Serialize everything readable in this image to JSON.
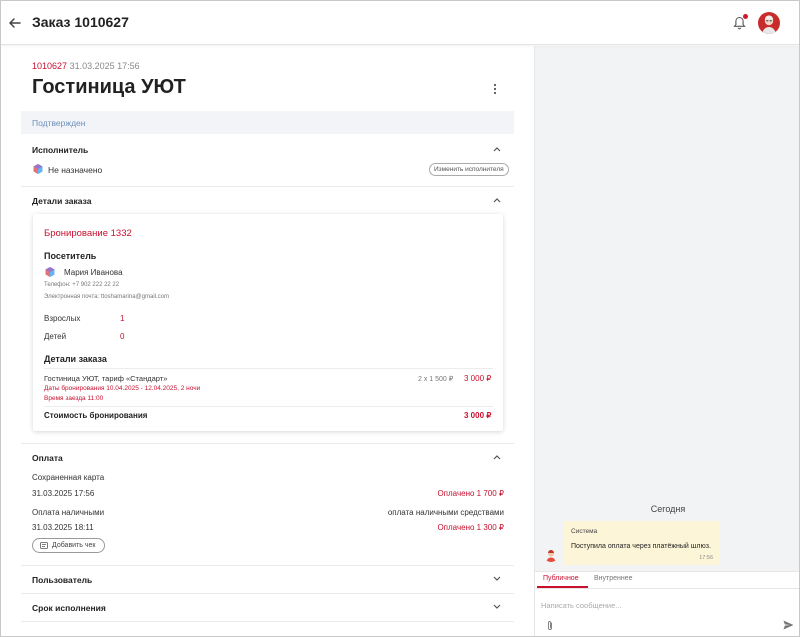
{
  "header": {
    "title": "Заказ 1010627"
  },
  "order": {
    "number": "1010627",
    "datetime": "31.03.2025 17:56",
    "title": "Гостиница УЮТ",
    "status": "Подтвержден"
  },
  "executor": {
    "heading": "Исполнитель",
    "value": "Не назначено",
    "change_button": "Изменить исполнителя"
  },
  "order_details": {
    "heading": "Детали заказа",
    "card": {
      "booking_title": "Бронирование 1332",
      "visitor_heading": "Посетитель",
      "visitor_name": "Мария Иванова",
      "phone": "Телефон: +7 902 222 22 22",
      "email": "Электронная почта: ttoshamarina@gmail.com",
      "adults_label": "Взрослых",
      "adults_value": "1",
      "children_label": "Детей",
      "children_value": "0",
      "details_heading": "Детали заказа",
      "item_name": "Гостиница УЮТ, тариф «Стандарт»",
      "item_dates": "Даты бронирования 10.04.2025 - 12.04.2025, 2 ночи",
      "item_checkin": "Время заезда 11:00",
      "item_qty": "2 x 1 500 ₽",
      "item_total": "3 000 ₽",
      "total_label": "Стоимость бронирования",
      "total_value": "3 000 ₽"
    }
  },
  "payment": {
    "heading": "Оплата",
    "card_label": "Сохраненная карта",
    "card_date": "31.03.2025 17:56",
    "card_status": "Оплачено 1 700 ₽",
    "cash_label": "Оплата наличными",
    "cash_method": "оплата наличными средствами",
    "cash_date": "31.03.2025 18:11",
    "cash_status": "Оплачено 1 300 ₽",
    "add_check_button": "Добавить чек"
  },
  "user_section": {
    "heading": "Пользователь"
  },
  "deadline_section": {
    "heading": "Срок исполнения"
  },
  "chat": {
    "date_label": "Сегодня",
    "message": {
      "author": "Система",
      "text": "Поступила оплата через платёжный шлюз.",
      "time": "17:56"
    },
    "tabs": [
      {
        "label": "Публичное"
      },
      {
        "label": "Внутреннее"
      }
    ],
    "input_placeholder": "Написать сообщение..."
  },
  "colors": {
    "accent": "#c8102e",
    "status_text": "#6e8fb9",
    "status_bg": "#f2f4f8",
    "message_bg": "#fdf5d8"
  }
}
